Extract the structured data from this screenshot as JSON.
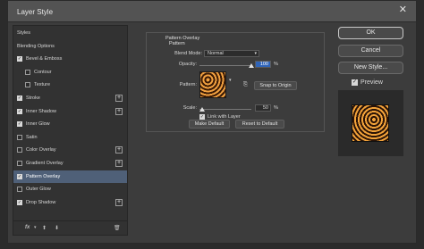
{
  "dialog": {
    "title": "Layer Style"
  },
  "sidebar": {
    "items": [
      {
        "label": "Styles",
        "checkbox": false,
        "checked": false,
        "plus": false,
        "indent": false,
        "active": false
      },
      {
        "label": "Blending Options",
        "checkbox": false,
        "checked": false,
        "plus": false,
        "indent": false,
        "active": false
      },
      {
        "label": "Bevel & Emboss",
        "checkbox": true,
        "checked": true,
        "plus": false,
        "indent": false,
        "active": false
      },
      {
        "label": "Contour",
        "checkbox": true,
        "checked": false,
        "plus": false,
        "indent": true,
        "active": false
      },
      {
        "label": "Texture",
        "checkbox": true,
        "checked": false,
        "plus": false,
        "indent": true,
        "active": false
      },
      {
        "label": "Stroke",
        "checkbox": true,
        "checked": true,
        "plus": true,
        "indent": false,
        "active": false
      },
      {
        "label": "Inner Shadow",
        "checkbox": true,
        "checked": true,
        "plus": true,
        "indent": false,
        "active": false
      },
      {
        "label": "Inner Glow",
        "checkbox": true,
        "checked": true,
        "plus": false,
        "indent": false,
        "active": false
      },
      {
        "label": "Satin",
        "checkbox": true,
        "checked": false,
        "plus": false,
        "indent": false,
        "active": false
      },
      {
        "label": "Color Overlay",
        "checkbox": true,
        "checked": false,
        "plus": true,
        "indent": false,
        "active": false
      },
      {
        "label": "Gradient Overlay",
        "checkbox": true,
        "checked": false,
        "plus": true,
        "indent": false,
        "active": false
      },
      {
        "label": "Pattern Overlay",
        "checkbox": true,
        "checked": true,
        "plus": false,
        "indent": false,
        "active": true
      },
      {
        "label": "Outer Glow",
        "checkbox": true,
        "checked": false,
        "plus": false,
        "indent": false,
        "active": false
      },
      {
        "label": "Drop Shadow",
        "checkbox": true,
        "checked": true,
        "plus": true,
        "indent": false,
        "active": false
      }
    ],
    "footer": {
      "fx_label": "fx"
    }
  },
  "pattern_overlay": {
    "group_title": "Pattern Overlay",
    "subgroup_title": "Pattern",
    "blend_mode_label": "Blend Mode:",
    "blend_mode_value": "Normal",
    "opacity_label": "Opacity:",
    "opacity_value": "100",
    "opacity_unit": "%",
    "opacity_level": 1.0,
    "pattern_label": "Pattern:",
    "snap_button": "Snap to Origin",
    "scale_label": "Scale:",
    "scale_value": "50",
    "scale_unit": "%",
    "scale_level": 0.05,
    "link_label": "Link with Layer",
    "make_default": "Make Default",
    "reset_default": "Reset to Default"
  },
  "actions": {
    "ok": "OK",
    "cancel": "Cancel",
    "new_style": "New Style...",
    "preview_label": "Preview"
  },
  "colors": {
    "accent": "#4f6078",
    "highlight": "#2f64b8",
    "pattern_orange": "#f0a040"
  }
}
